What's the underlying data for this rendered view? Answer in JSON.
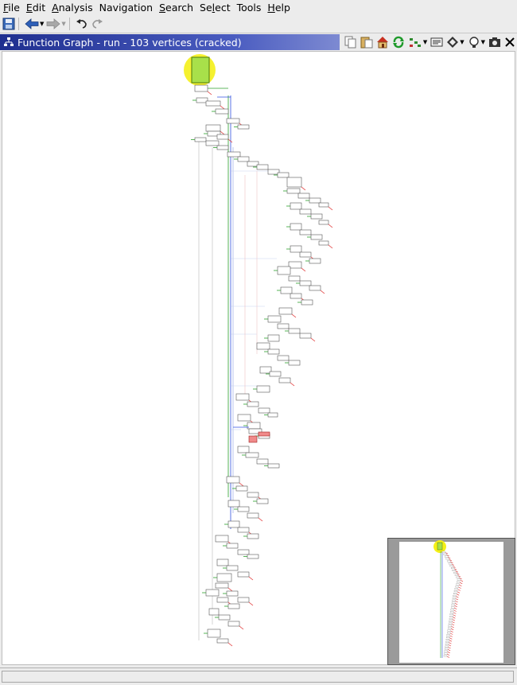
{
  "menubar": {
    "items": [
      {
        "first": "F",
        "rest": "ile"
      },
      {
        "first": "E",
        "rest": "dit"
      },
      {
        "first": "A",
        "rest": "nalysis"
      },
      {
        "first": "",
        "rest": "Navigation",
        "mn_index": 0
      },
      {
        "first": "S",
        "rest": "earch"
      },
      {
        "pre": "Se",
        "first": "l",
        "rest": "ect"
      },
      {
        "first": "",
        "rest": "Tools"
      },
      {
        "first": "H",
        "rest": "elp"
      }
    ]
  },
  "window": {
    "title": "Function Graph - run - 103 vertices  (cracked)"
  },
  "status": {
    "text": ""
  },
  "colors": {
    "entry_block": "#a8e04a",
    "highlight": "#f4f018",
    "selected_block": "#f08a8a",
    "titlebar_start": "#1f2f8f",
    "edge_true": "#2ca02c",
    "edge_false": "#e03030",
    "edge_uncond": "#3050e0"
  },
  "icons": [
    "save-icon",
    "back-arrow-icon",
    "forward-arrow-icon",
    "undo-icon",
    "redo-icon",
    "copy-icon",
    "paste-icon",
    "home-icon",
    "refresh-icon",
    "layout-icon",
    "snapshot-icon",
    "navigate-icon",
    "hover-icon",
    "camera-icon",
    "close-icon"
  ]
}
